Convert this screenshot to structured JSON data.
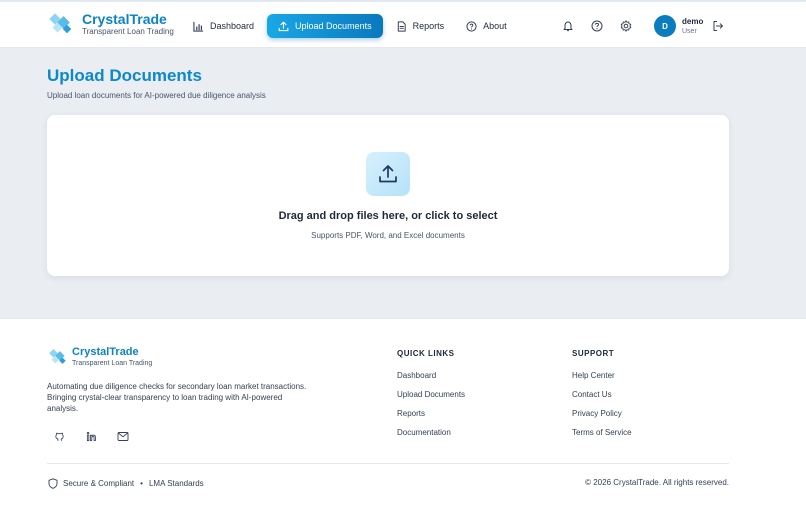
{
  "header": {
    "brand": {
      "title": "CrystalTrade",
      "tagline": "Transparent Loan Trading"
    },
    "nav": [
      {
        "label": "Dashboard",
        "icon": "bar-chart-icon",
        "active": false
      },
      {
        "label": "Upload Documents",
        "icon": "upload-icon",
        "active": true
      },
      {
        "label": "Reports",
        "icon": "file-text-icon",
        "active": false
      },
      {
        "label": "About",
        "icon": "help-circle-icon",
        "active": false
      }
    ],
    "icons": [
      "bell-icon",
      "help-icon",
      "gear-icon"
    ],
    "user": {
      "initial": "D",
      "name": "demo",
      "role": "User"
    }
  },
  "main": {
    "title": "Upload Documents",
    "subtitle": "Upload loan documents for AI-powered due diligence analysis",
    "dropzone": {
      "title": "Drag and drop files here, or click to select",
      "subtitle": "Supports PDF, Word, and Excel documents"
    }
  },
  "footer": {
    "brand": {
      "title": "CrystalTrade",
      "tagline": "Transparent Loan Trading"
    },
    "description": "Automating due diligence checks for secondary loan market transactions. Bringing crystal-clear transparency to loan trading with AI-powered analysis.",
    "quick_links": {
      "heading": "QUICK LINKS",
      "items": [
        "Dashboard",
        "Upload Documents",
        "Reports",
        "Documentation"
      ]
    },
    "support": {
      "heading": "SUPPORT",
      "items": [
        "Help Center",
        "Contact Us",
        "Privacy Policy",
        "Terms of Service"
      ]
    },
    "badges": {
      "secure": "Secure & Compliant",
      "separator": "•",
      "standards": "LMA Standards"
    },
    "copyright": "© 2026 CrystalTrade. All rights reserved."
  },
  "colors": {
    "accent": "#0b89cc",
    "accent_dark": "#0a78bd",
    "avatar": "#0b7cc0"
  }
}
